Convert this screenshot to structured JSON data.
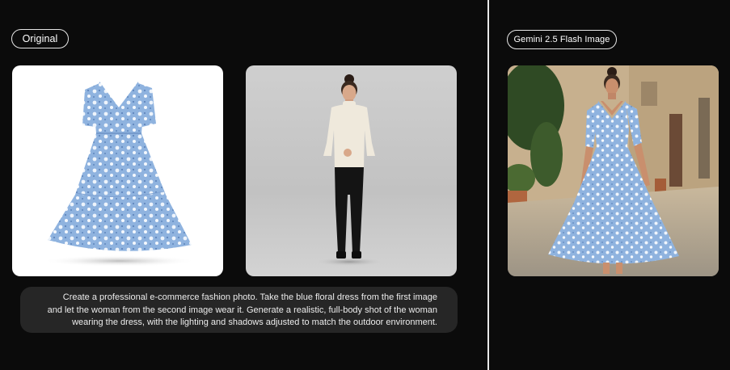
{
  "labels": {
    "original": "Original",
    "result_model": "Gemini 2.5 Flash Image"
  },
  "prompt": {
    "lines": [
      "Create a professional e-commerce fashion photo. Take the blue floral dress from the first image",
      "and let the woman from the second image wear it. Generate a realistic, full-body shot of the woman",
      "wearing the dress, with the lighting and shadows adjusted to match the outdoor environment."
    ]
  },
  "colors": {
    "background": "#0b0b0b",
    "prompt_background": "#262626",
    "dress_blue": "#8fb3df",
    "divider": "#e8e8e8"
  },
  "images": {
    "dress": "blue-floral-dress-photo",
    "woman": "woman-in-cream-sweater-photo",
    "result": "woman-wearing-floral-dress-outdoor-photo"
  }
}
